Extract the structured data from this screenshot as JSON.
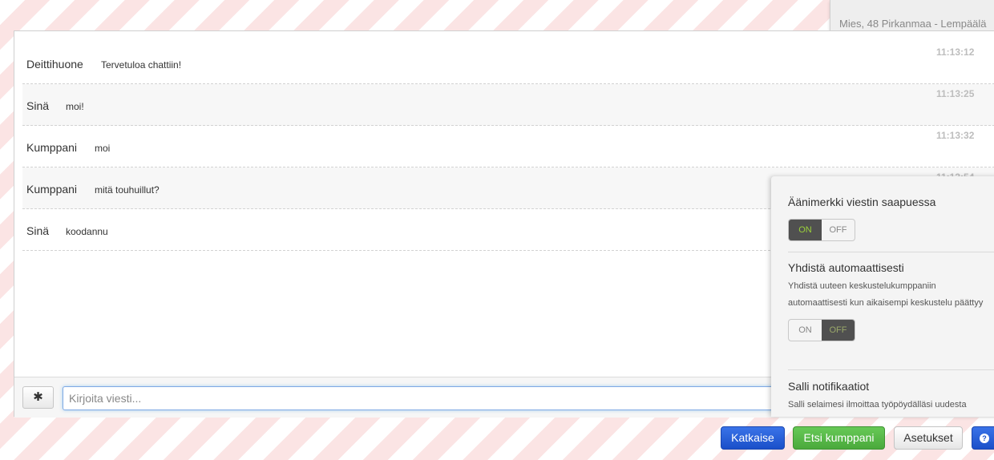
{
  "partner": {
    "info": "Mies, 48 Pirkanmaa - Lempäälä"
  },
  "messages": [
    {
      "sender": "Deittihuone",
      "text": "Tervetuloa chattiin!",
      "time": "11:13:12"
    },
    {
      "sender": "Sinä",
      "text": "moi!",
      "time": "11:13:25"
    },
    {
      "sender": "Kumppani",
      "text": "moi",
      "time": "11:13:32"
    },
    {
      "sender": "Kumppani",
      "text": "mitä touhuillut?",
      "time": "11:13:54"
    },
    {
      "sender": "Sinä",
      "text": "koodannu",
      "time": ""
    }
  ],
  "input": {
    "placeholder": "Kirjoita viesti...",
    "emoji_button": "✱"
  },
  "settings": {
    "sound": {
      "title": "Äänimerkki viestin saapuessa",
      "on": "ON",
      "off": "OFF",
      "state": "on"
    },
    "auto_connect": {
      "title": "Yhdistä automaattisesti",
      "desc_line1": "Yhdistä uuteen keskustelukumppaniin",
      "desc_line2": "automaattisesti kun aikaisempi keskustelu päättyy",
      "on": "ON",
      "off": "OFF",
      "state": "off"
    },
    "notifications": {
      "title": "Salli notifikaatiot",
      "desc_line1": "Salli selaimesi ilmoittaa työpöydälläsi uudesta"
    }
  },
  "buttons": {
    "disconnect": "Katkaise",
    "find_partner": "Etsi kumppani",
    "settings": "Asetukset",
    "help": "?"
  },
  "colors": {
    "primary": "#1a4fc9",
    "success": "#4aa93c",
    "toggle_active": "#505050"
  }
}
